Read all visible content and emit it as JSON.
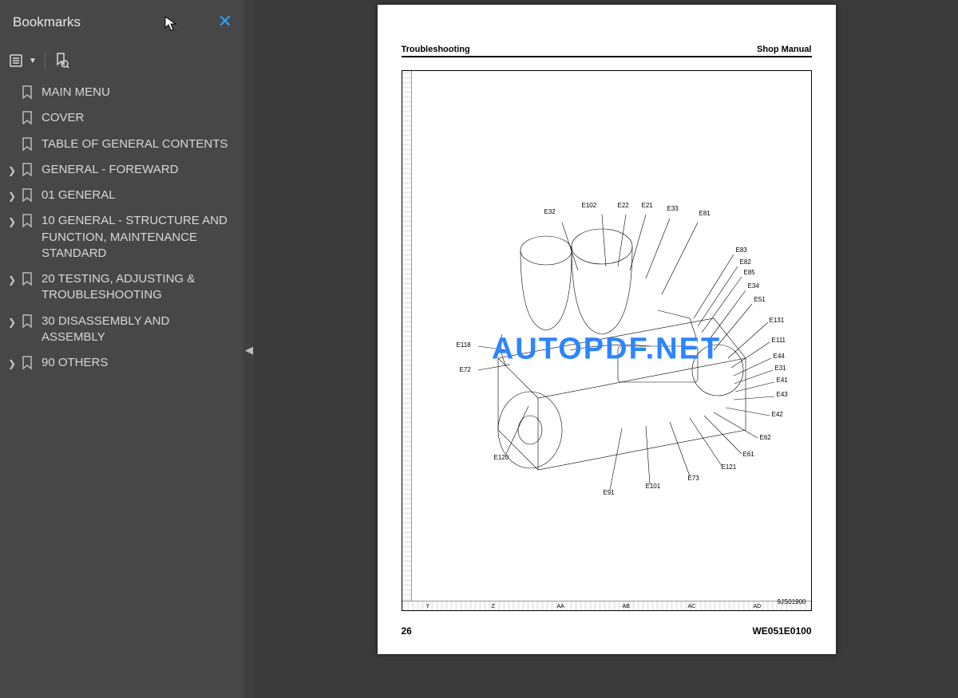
{
  "sidebar": {
    "title": "Bookmarks",
    "items": [
      {
        "label": "MAIN MENU",
        "expandable": false
      },
      {
        "label": "COVER",
        "expandable": false
      },
      {
        "label": "TABLE OF GENERAL CONTENTS",
        "expandable": false
      },
      {
        "label": "GENERAL - FOREWARD",
        "expandable": true
      },
      {
        "label": "01 GENERAL",
        "expandable": true
      },
      {
        "label": "10 GENERAL - STRUCTURE AND FUNCTION, MAINTENANCE STANDARD",
        "expandable": true
      },
      {
        "label": "20 TESTING, ADJUSTING & TROUBLESHOOTING",
        "expandable": true
      },
      {
        "label": "30 DISASSEMBLY AND ASSEMBLY",
        "expandable": true
      },
      {
        "label": "90 OTHERS",
        "expandable": true
      }
    ]
  },
  "page": {
    "header_left": "Troubleshooting",
    "header_right": "Shop Manual",
    "footer_left": "26",
    "footer_right": "WE051E0100",
    "diagram_code": "9JS01900",
    "grid_cols": [
      "Y",
      "Z",
      "AA",
      "AB",
      "AC",
      "AD"
    ],
    "callouts": [
      "E32",
      "E102",
      "E22",
      "E21",
      "E33",
      "E81",
      "E83",
      "E82",
      "E85",
      "E34",
      "E51",
      "E131",
      "E111",
      "E44",
      "E31",
      "E41",
      "E43",
      "E42",
      "E62",
      "E61",
      "E121",
      "E73",
      "E101",
      "E91",
      "E120",
      "E72",
      "E118"
    ]
  },
  "watermark": "AUTOPDF.NET"
}
